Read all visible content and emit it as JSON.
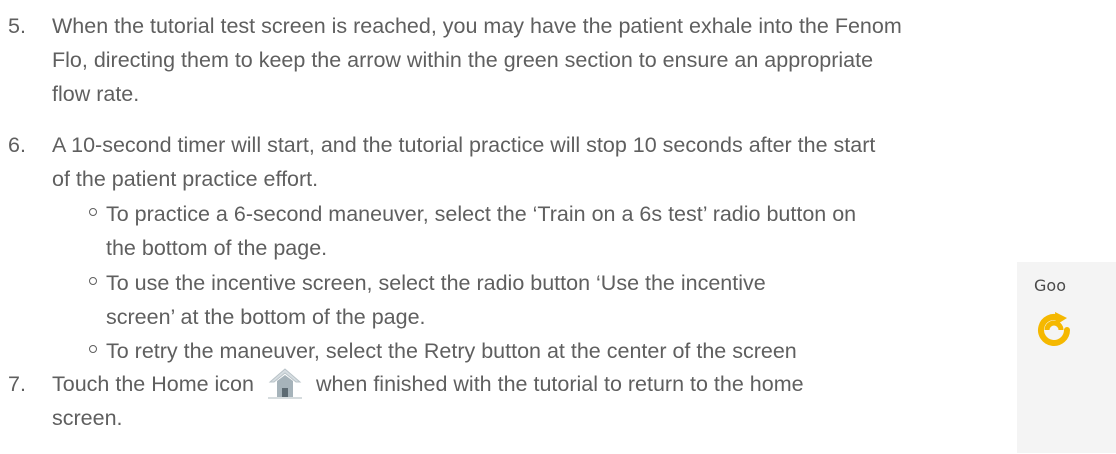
{
  "steps": [
    {
      "number": "5.",
      "lines": [
        "When the tutorial test screen is reached, you may have the patient exhale into the Fenom",
        "Flo, directing them to keep the arrow within the green section to ensure an appropriate",
        "flow rate."
      ]
    },
    {
      "number": "6.",
      "lines": [
        "A 10-second timer will start, and the tutorial practice will stop 10 seconds after the start",
        "of the patient practice effort."
      ],
      "bullets": [
        {
          "lines": [
            "To practice a 6-second maneuver, select the ‘Train on a 6s test’ radio button on",
            "the bottom of the page."
          ]
        },
        {
          "lines": [
            "To use the incentive screen, select the radio button ‘Use the incentive",
            "screen’ at the bottom of the page."
          ]
        },
        {
          "lines": [
            "To retry the maneuver, select the Retry button at the center of the screen"
          ]
        }
      ]
    },
    {
      "number": "7.",
      "line1_before": "Touch the Home icon",
      "line1_after": "when finished with the tutorial to return to the home",
      "line2": "screen."
    }
  ],
  "side_panel": {
    "text": "Goo"
  },
  "icons": {
    "home": "home-icon",
    "retry": "retry-icon"
  },
  "colors": {
    "text": "#5f5f5f",
    "panel": "#f4f4f4",
    "retry": "#f5b800"
  }
}
